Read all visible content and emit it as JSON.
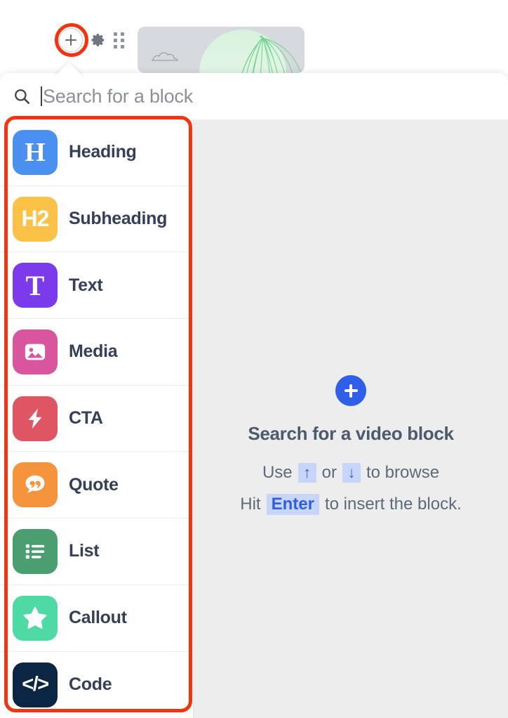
{
  "toolbar": {
    "add_block_button": "+",
    "settings_icon": "gear-icon",
    "drag_handle_icon": "drag-handle-icon"
  },
  "banner": {
    "alt": "palm leaves and clouds illustration"
  },
  "search": {
    "icon": "search-icon",
    "value": "",
    "placeholder": "Search for a block"
  },
  "blocks": [
    {
      "label": "Heading",
      "glyph": "H",
      "icon": "heading-icon",
      "color": "#4a90f0"
    },
    {
      "label": "Subheading",
      "glyph": "H2",
      "icon": "subheading-icon",
      "color": "#fcc247"
    },
    {
      "label": "Text",
      "glyph": "T",
      "icon": "text-icon",
      "color": "#7c3aed"
    },
    {
      "label": "Media",
      "glyph": "",
      "icon": "media-icon",
      "color": "#d9569f"
    },
    {
      "label": "CTA",
      "glyph": "",
      "icon": "cta-bolt-icon",
      "color": "#e05563"
    },
    {
      "label": "Quote",
      "glyph": "",
      "icon": "quote-icon",
      "color": "#f5943c"
    },
    {
      "label": "List",
      "glyph": "",
      "icon": "list-icon",
      "color": "#4a9e70"
    },
    {
      "label": "Callout",
      "glyph": "",
      "icon": "callout-star-icon",
      "color": "#4fd9a5"
    },
    {
      "label": "Code",
      "glyph": "</>",
      "icon": "code-icon",
      "color": "#0b2545"
    }
  ],
  "empty_state": {
    "plus_icon": "plus-circle-icon",
    "title": "Search for a video block",
    "hint_line_1": {
      "prefix": "Use",
      "key_up": "↑",
      "middle": "or",
      "key_down": "↓",
      "suffix": "to browse"
    },
    "hint_line_2": {
      "prefix": "Hit",
      "key_enter": "Enter",
      "suffix": "to insert the block."
    }
  },
  "annotations": {
    "add_button_ring": "#f4340e",
    "block_list_box": "#f4340e"
  }
}
